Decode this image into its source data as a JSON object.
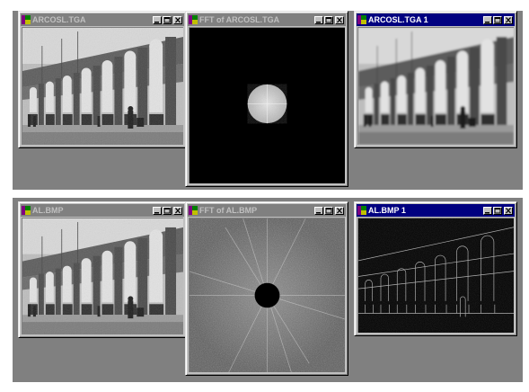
{
  "windows": {
    "top_left": {
      "title": "ARCOSL.TGA",
      "active": false
    },
    "top_mid": {
      "title": "FFT of ARCOSL.TGA",
      "active": false
    },
    "top_right": {
      "title": "ARCOSL.TGA 1",
      "active": true
    },
    "bot_left": {
      "title": "AL.BMP",
      "active": false
    },
    "bot_mid": {
      "title": "FFT of AL.BMP",
      "active": false
    },
    "bot_right": {
      "title": "AL.BMP 1",
      "active": true
    }
  },
  "icons": {
    "app": "app-icon",
    "minimize": "minimize-icon",
    "maximize": "maximize-icon",
    "close": "close-icon"
  },
  "colors": {
    "workspace": "#808080",
    "active_title": "#000080",
    "inactive_title": "#808080",
    "window_face": "#c0c0c0"
  }
}
